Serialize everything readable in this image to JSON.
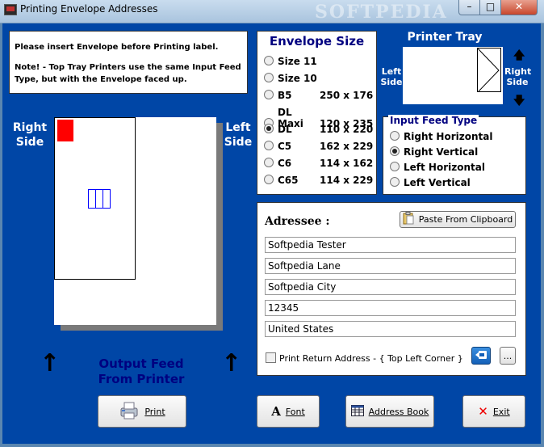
{
  "window": {
    "title": "Printing Envelope Addresses",
    "watermark": "SOFTPEDIA",
    "minimize_glyph": "–",
    "maximize_glyph": "□",
    "close_glyph": "✕"
  },
  "notice": {
    "line1": "Please insert Envelope before Printing label.",
    "line2": "Note!  -  Top Tray Printers use the same Input Feed Type, but  with the Envelope faced up."
  },
  "preview": {
    "right_side_label": "Right Side",
    "left_side_label": "Left Side",
    "output_feed_label": "Output Feed From Printer",
    "arrow_glyph": "↑"
  },
  "envelope_size": {
    "title": "Envelope Size",
    "selected": "DL",
    "options": [
      {
        "label": "Size 11",
        "dims": ""
      },
      {
        "label": "Size 10",
        "dims": ""
      },
      {
        "label": "B5",
        "dims": "250 x 176"
      },
      {
        "label": "DL Maxi",
        "dims": "120 x 235"
      },
      {
        "label": "DL",
        "dims": "110 x 220"
      },
      {
        "label": "C5",
        "dims": "162 x 229"
      },
      {
        "label": "C6",
        "dims": "114 x 162"
      },
      {
        "label": "C65",
        "dims": "114 x 229"
      }
    ]
  },
  "printer_tray": {
    "title": "Printer Tray",
    "left_label": "Left Side",
    "right_label": "Right Side",
    "up_glyph": "🡅",
    "down_glyph": "🡇"
  },
  "input_feed": {
    "legend": "Input Feed Type",
    "selected": "Right Vertical",
    "options": [
      "Right Horizontal",
      "Right Vertical",
      "Left Horizontal",
      "Left Vertical"
    ]
  },
  "addressee": {
    "title": "Adressee :",
    "paste_button": "Paste From Clipboard",
    "lines": [
      "Softpedia Tester",
      "Softpedia Lane",
      "Softpedia City",
      "12345",
      "United States"
    ],
    "print_return_label": "Print Return Address - { Top Left Corner }",
    "ellipsis_button": "..."
  },
  "buttons": {
    "print": "Print",
    "font": "Font",
    "address_book": "Address Book",
    "exit": "Exit"
  },
  "colors": {
    "client_bg": "#0046a6",
    "stamp": "#ff0000",
    "heading_blue": "#000080"
  }
}
